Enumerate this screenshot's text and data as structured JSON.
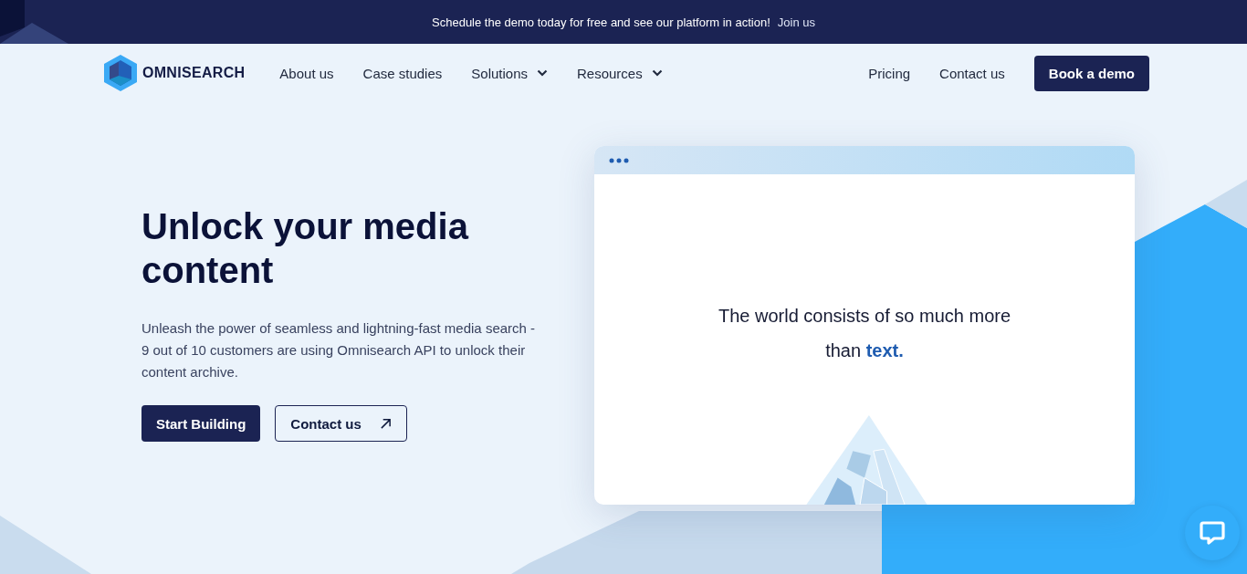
{
  "announcement": {
    "text": "Schedule the demo today for free and see our platform in action!",
    "link": "Join us"
  },
  "nav": {
    "logo": "OMNISEARCH",
    "items": [
      {
        "label": "About us",
        "kind": "link"
      },
      {
        "label": "Case studies",
        "kind": "link"
      },
      {
        "label": "Solutions",
        "kind": "dropdown"
      },
      {
        "label": "Resources",
        "kind": "dropdown"
      }
    ],
    "right_items": [
      {
        "label": "Pricing"
      },
      {
        "label": "Contact us"
      }
    ],
    "cta": "Book a demo"
  },
  "hero": {
    "title": "Unlock your media content",
    "description": "Unleash the power of seamless and lightning-fast media search - 9 out of 10 customers are using Omnisearch API to unlock their content archive.",
    "buttons": [
      {
        "label": "Start Building",
        "kind": "primary"
      },
      {
        "label": "Contact us",
        "kind": "outline"
      }
    ]
  },
  "mockup": {
    "text": "The world consists of so much more than **text.**"
  }
}
